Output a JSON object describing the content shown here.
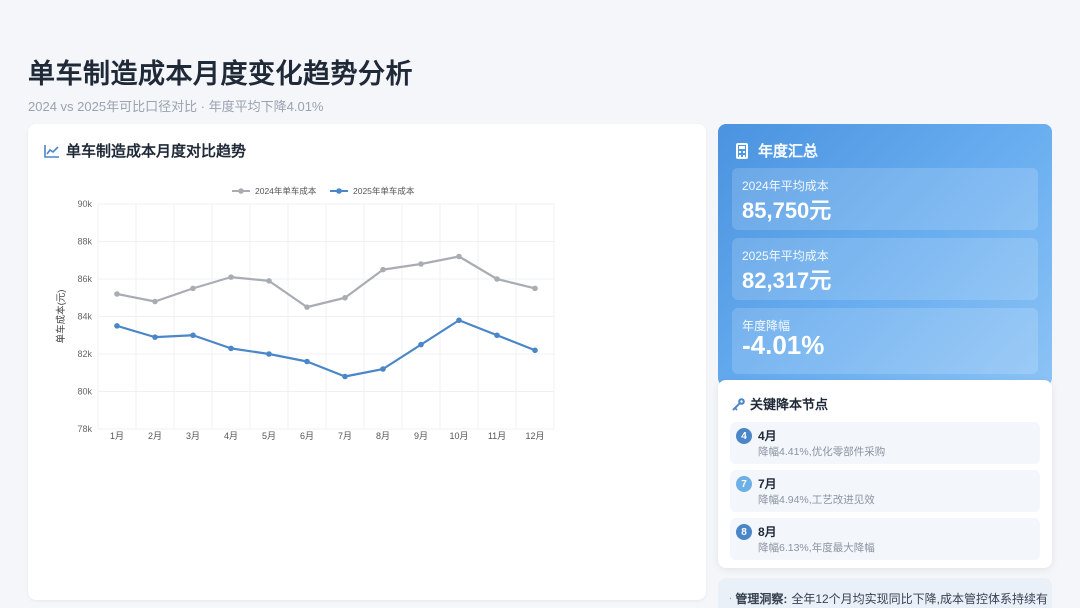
{
  "page": {
    "title": "单车制造成本月度变化趋势分析",
    "subtitle": "2024 vs 2025年可比口径对比 · 年度平均下降4.01%"
  },
  "chart_card": {
    "title": "单车制造成本月度对比趋势"
  },
  "chart_data": {
    "type": "line",
    "title": "单车制造成本月度对比趋势",
    "categories": [
      "1月",
      "2月",
      "3月",
      "4月",
      "5月",
      "6月",
      "7月",
      "8月",
      "9月",
      "10月",
      "11月",
      "12月"
    ],
    "series": [
      {
        "name": "2024年单车成本",
        "color": "#a9adb3",
        "values": [
          85200,
          84800,
          85500,
          86100,
          85900,
          84500,
          85000,
          86500,
          86800,
          87200,
          86000,
          85500
        ]
      },
      {
        "name": "2025年单车成本",
        "color": "#4a86c8",
        "values": [
          83500,
          82900,
          83000,
          82300,
          82000,
          81600,
          80800,
          81200,
          82500,
          83800,
          83000,
          82200
        ]
      }
    ],
    "ylabel": "单车成本(元)",
    "xlabel": "",
    "ylim": [
      78000,
      90000
    ],
    "yticks": [
      {
        "value": 90000,
        "label": "90k"
      },
      {
        "value": 88000,
        "label": "88k"
      },
      {
        "value": 86000,
        "label": "86k"
      },
      {
        "value": 84000,
        "label": "84k"
      },
      {
        "value": 82000,
        "label": "82k"
      },
      {
        "value": 80000,
        "label": "80k"
      },
      {
        "value": 78000,
        "label": "78k"
      }
    ],
    "grid": true,
    "legend": "top-center"
  },
  "summary": {
    "title": "年度汇总",
    "avg2024_label": "2024年平均成本",
    "avg2024_value": "85,750元",
    "avg2025_label": "2025年平均成本",
    "avg2025_value": "82,317元",
    "decline_label": "年度降幅",
    "decline_value": "-4.01%"
  },
  "key_nodes": {
    "title": "关键降本节点",
    "items": [
      {
        "badge": "4",
        "month": "4月",
        "desc": "降幅4.41%,优化零部件采购",
        "color": "#4a86c8"
      },
      {
        "badge": "7",
        "month": "7月",
        "desc": "降幅4.94%,工艺改进见效",
        "color": "#6cb0e6"
      },
      {
        "badge": "8",
        "month": "8月",
        "desc": "降幅6.13%,年度最大降幅",
        "color": "#4a86c8"
      }
    ]
  },
  "insight": {
    "label": "管理洞察:",
    "text": "全年12个月均实现同比下降,成本管控体系持续有"
  },
  "colors": {
    "accent_blue": "#4a86c8",
    "series_gray": "#a9adb3",
    "summary_gradient_start": "#4a93df",
    "summary_gradient_end": "#8cc3f5"
  }
}
